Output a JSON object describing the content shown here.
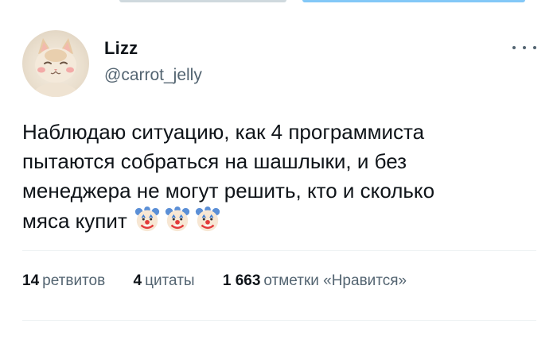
{
  "author": {
    "name": "Lizz",
    "handle": "@carrot_jelly",
    "avatar_icon": "cat-avatar"
  },
  "tweet": {
    "lines": [
      "Наблюдаю ситуацию, как 4 программиста",
      "пытаются собраться на шашлыки, и без",
      "менеджера не могут решить, кто и сколько",
      "мяса купит"
    ],
    "emojis": [
      "clown-face-icon",
      "clown-face-icon",
      "clown-face-icon"
    ]
  },
  "stats": {
    "retweets_count": "14",
    "retweets_label": "ретвитов",
    "quotes_count": "4",
    "quotes_label": "цитаты",
    "likes_count": "1 663",
    "likes_label": "отметки «Нравится»"
  },
  "colors": {
    "text": "#0f1419",
    "secondary": "#536471",
    "divider": "#eff3f4",
    "accent": "#1d9bf0"
  }
}
